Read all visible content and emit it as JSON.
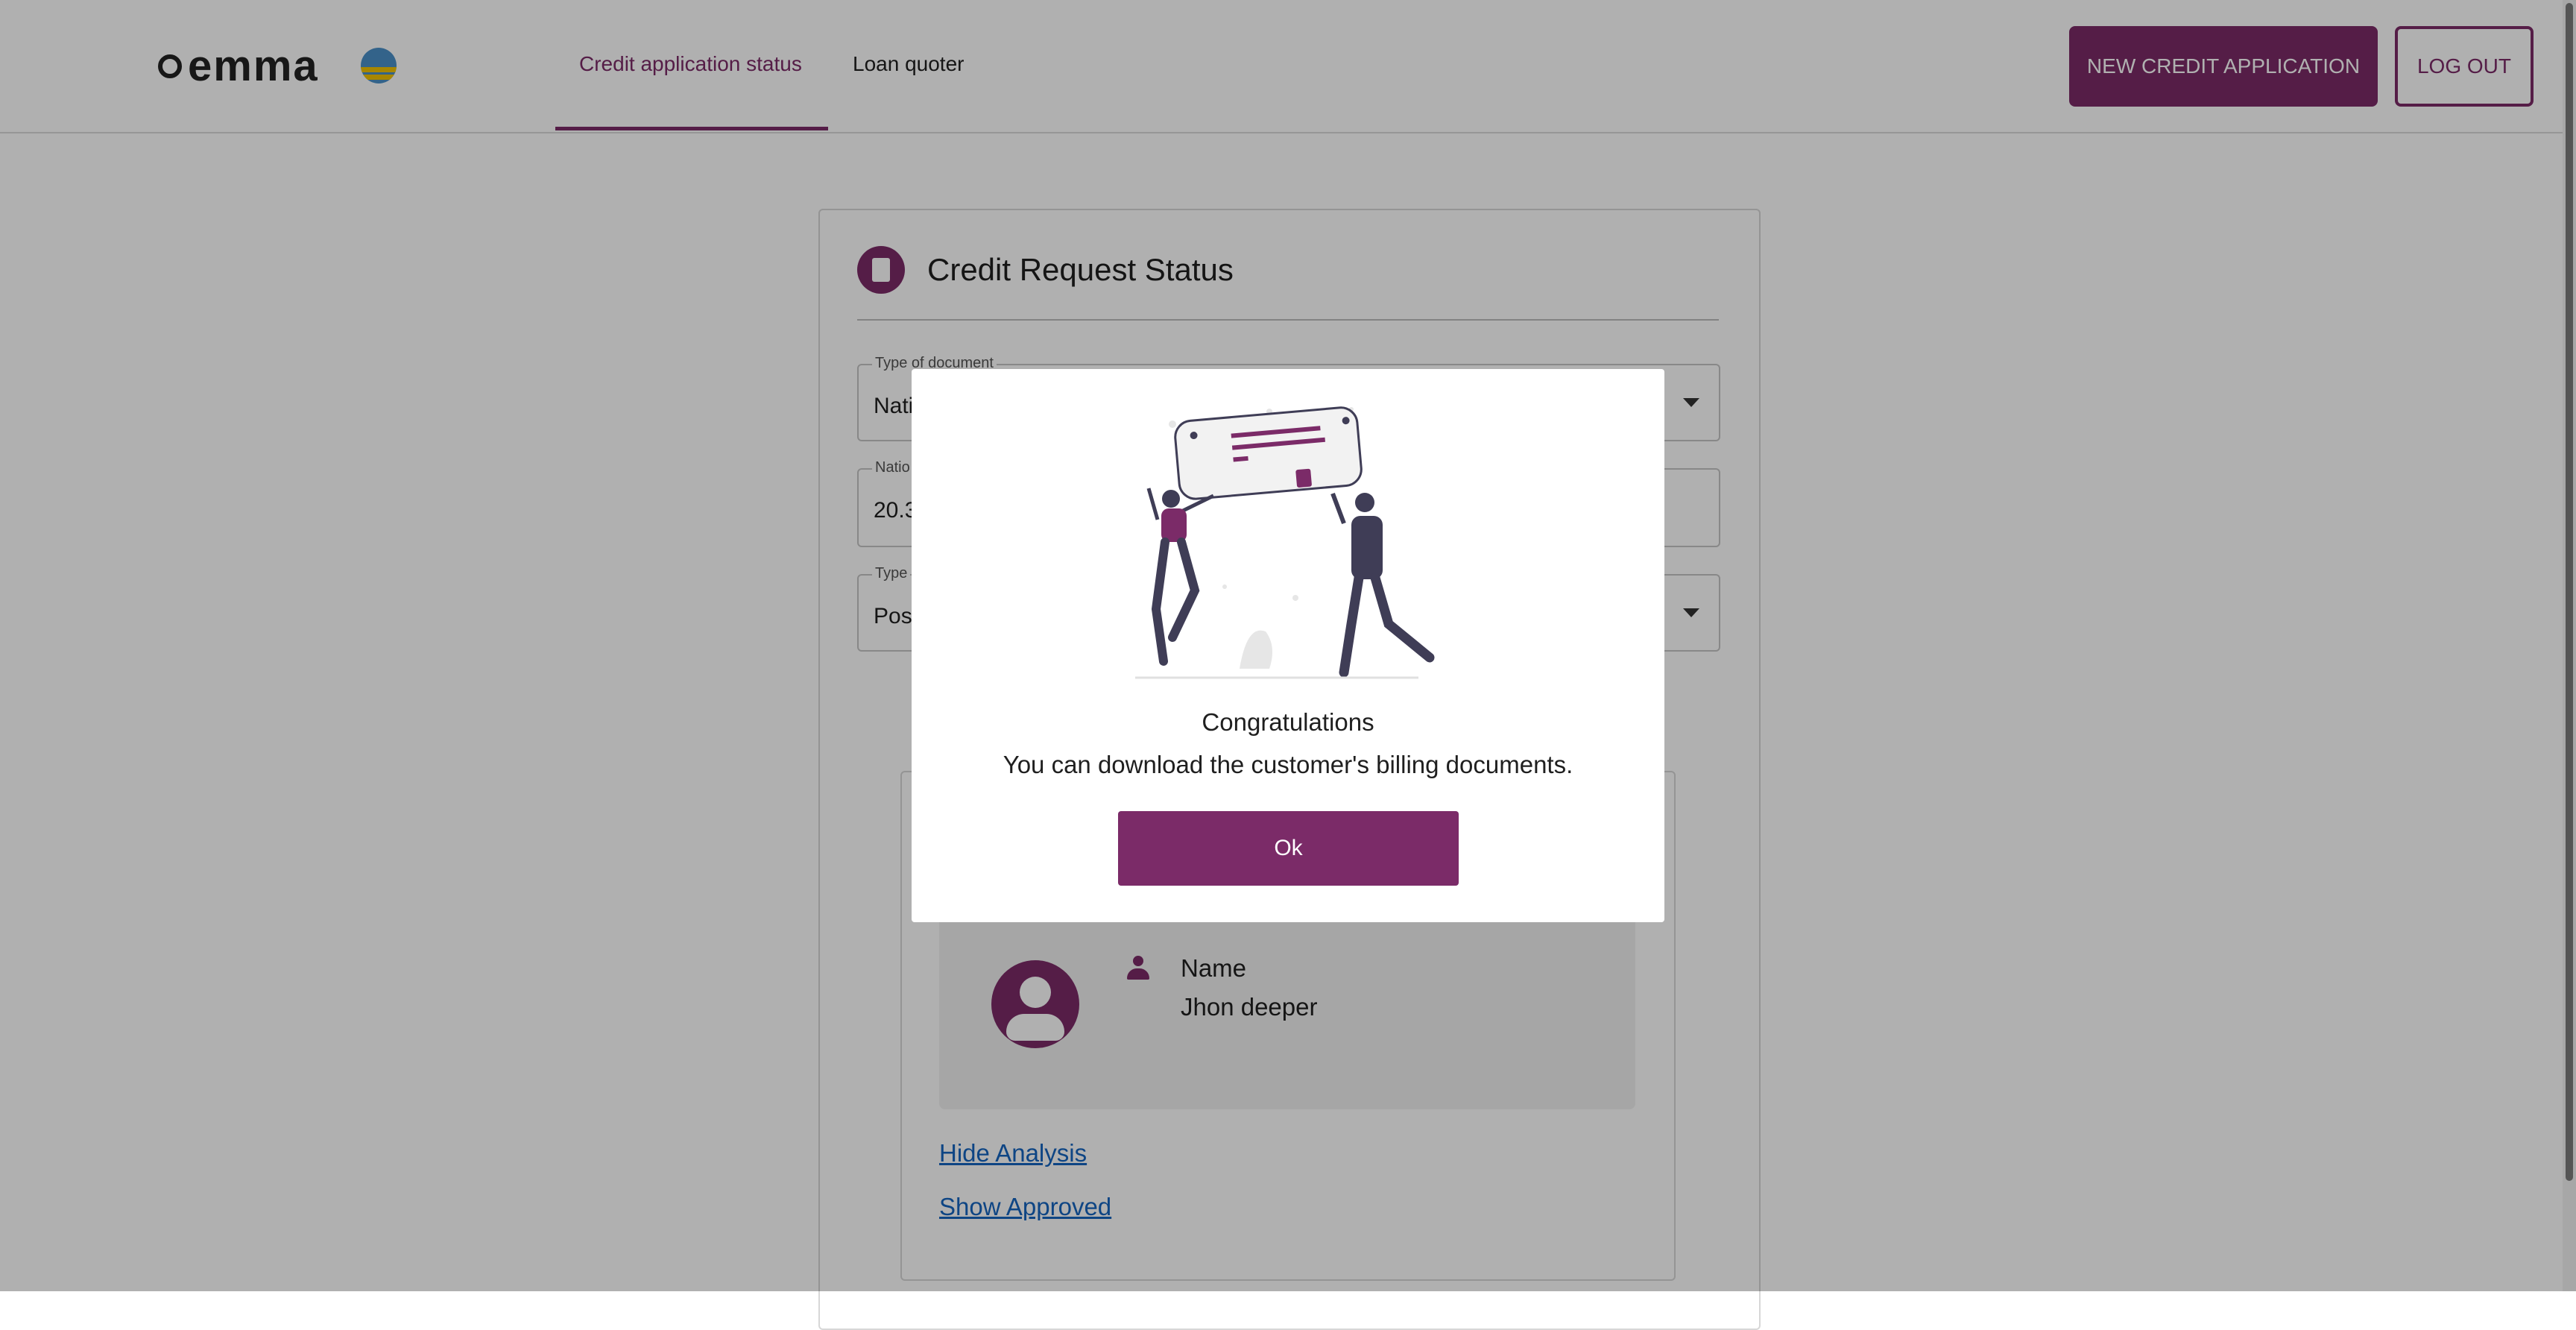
{
  "header": {
    "brand": "emma",
    "tabs": [
      {
        "label": "Credit application status",
        "active": true
      },
      {
        "label": "Loan quoter",
        "active": false
      }
    ],
    "new_application_label": "NEW CREDIT APPLICATION",
    "logout_label": "LOG OUT"
  },
  "card": {
    "title": "Credit Request Status",
    "fields": [
      {
        "label": "Type of document",
        "value": "Nati"
      },
      {
        "label": "Natio",
        "value": "20.3"
      },
      {
        "label": "Type",
        "value": "Post"
      }
    ],
    "profile": {
      "name_label": "Name",
      "name_value": "Jhon deeper"
    },
    "links": {
      "hide_analysis": "Hide Analysis",
      "show_approved": "Show Approved"
    }
  },
  "modal": {
    "title": "Congratulations",
    "message": "You can download the customer's billing documents.",
    "ok_label": "Ok"
  },
  "colors": {
    "accent": "#7b2b68",
    "link": "#1565c0"
  },
  "icons": [
    "brand-logo",
    "flag-icon",
    "document-check-icon",
    "dropdown-caret-icon",
    "avatar-icon",
    "person-icon",
    "celebration-illustration"
  ]
}
